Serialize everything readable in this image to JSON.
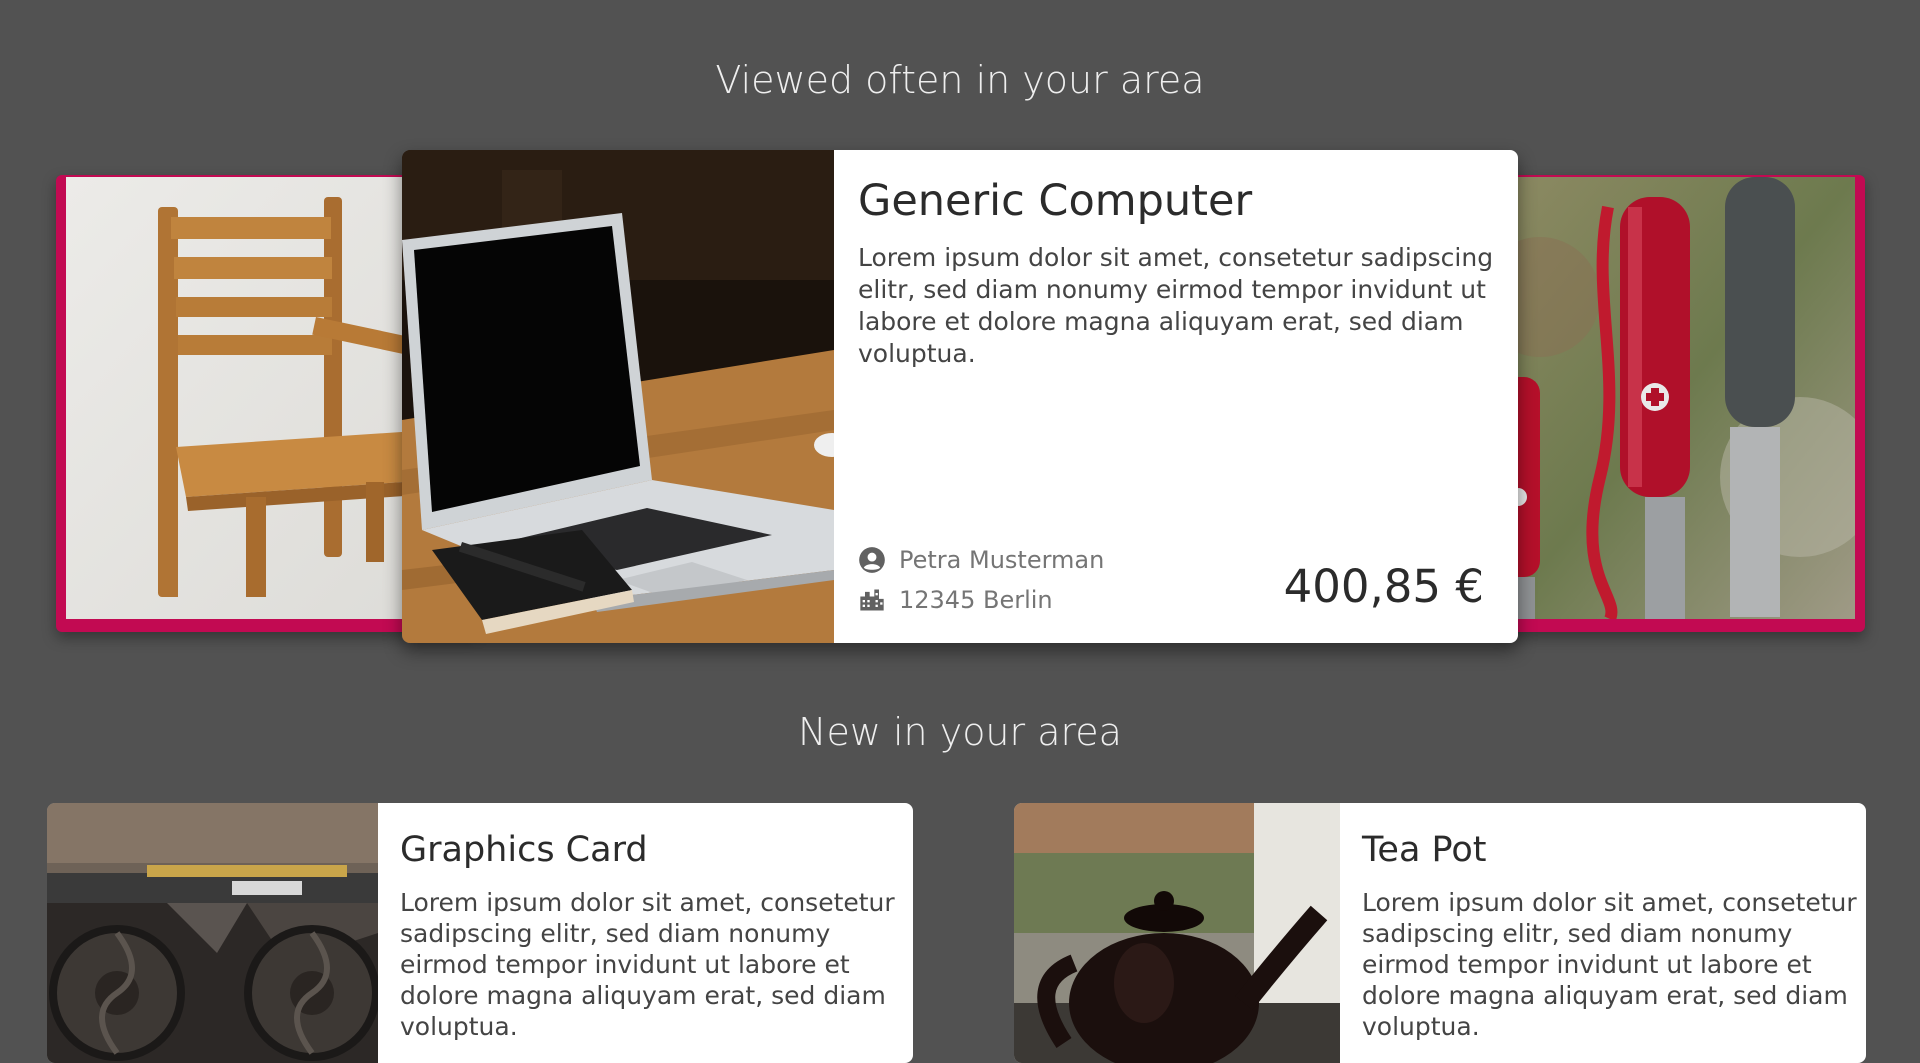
{
  "sections": {
    "viewed_title": "Viewed often in your area",
    "new_title": "New in your area"
  },
  "featured": {
    "title": "Generic Computer",
    "description": "Lorem ipsum dolor sit amet, consetetur sadipscing elitr, sed diam nonumy eirmod tempor invidunt ut labore et dolore magna aliquyam erat, sed diam voluptua.",
    "seller": "Petra Musterman",
    "location": "12345 Berlin",
    "price": "400,85 €",
    "icons": {
      "seller": "account-circle-icon",
      "location": "city-icon"
    }
  },
  "carousel_side_items": {
    "left_image": "wooden-chair-photo",
    "right_image": "pocket-knives-photo"
  },
  "new_items": [
    {
      "title": "Graphics Card",
      "description": "Lorem ipsum dolor sit amet, consetetur sadipscing elitr, sed diam nonumy eirmod tempor invidunt ut labore et dolore magna aliquyam erat, sed diam voluptua."
    },
    {
      "title": "Tea Pot",
      "description": "Lorem ipsum dolor sit amet, consetetur sadipscing elitr, sed diam nonumy eirmod tempor invidunt ut labore et dolore magna aliquyam erat, sed diam voluptua."
    }
  ],
  "colors": {
    "background": "#525252",
    "accent": "#c20a52",
    "card": "#ffffff",
    "title_text": "#eeeeee"
  }
}
